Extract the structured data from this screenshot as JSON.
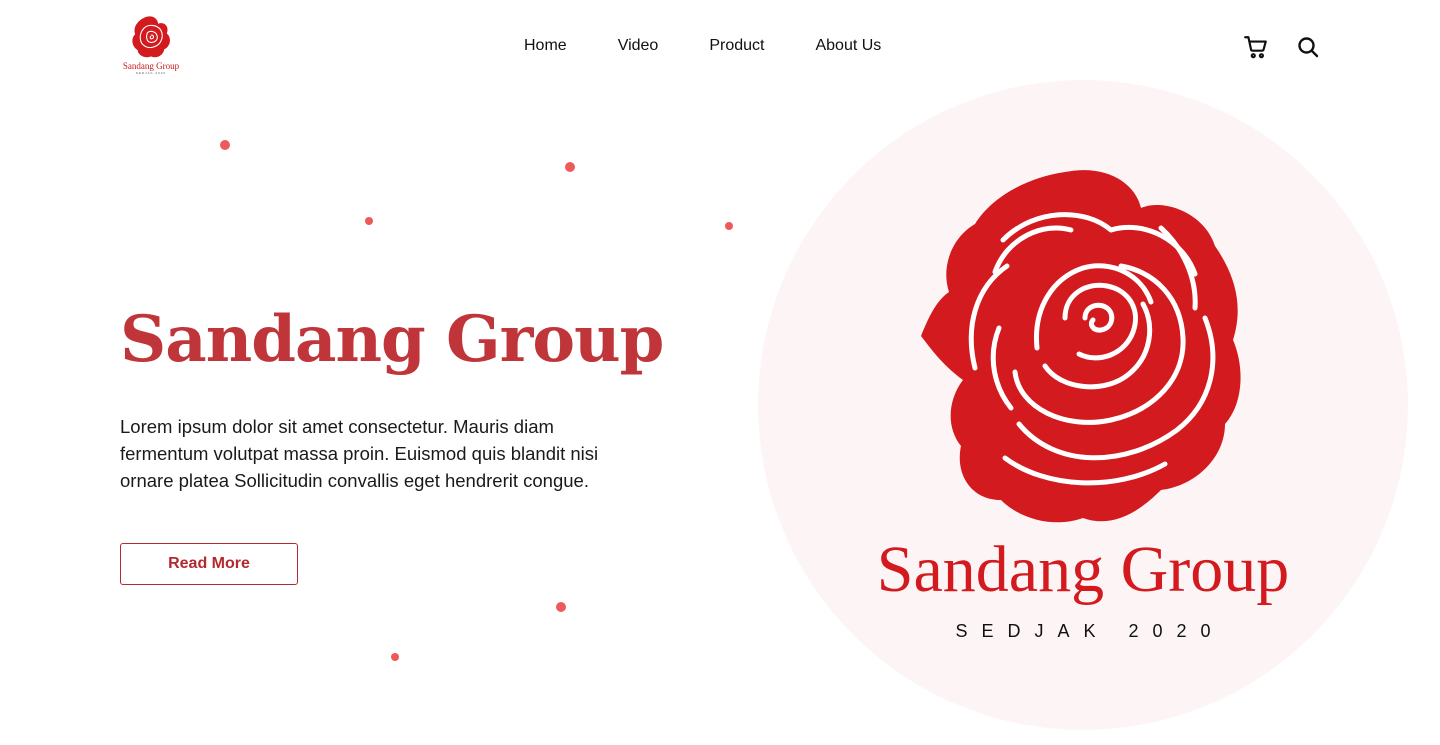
{
  "header": {
    "logo_text": "Sandang Group",
    "logo_sub": "SEDJAK 2020",
    "nav": [
      "Home",
      "Video",
      "Product",
      "About Us"
    ]
  },
  "icons": {
    "cart": "shopping-cart-icon",
    "search": "search-icon",
    "logo": "rose-icon"
  },
  "hero": {
    "title": "Sandang Group",
    "description": "Lorem ipsum dolor sit amet consectetur. Mauris diam fermentum volutpat massa proin. Euismod quis blandit nisi ornare platea Sollicitudin convallis eget hendrerit congue.",
    "cta_label": "Read More"
  },
  "brand": {
    "name": "Sandang Group",
    "tagline": "SEDJAK 2020"
  },
  "colors": {
    "accent": "#c0353a",
    "brand_red": "#d21a1f",
    "dot": "#ee5a5a",
    "circle_bg": "#fdf5f5"
  }
}
